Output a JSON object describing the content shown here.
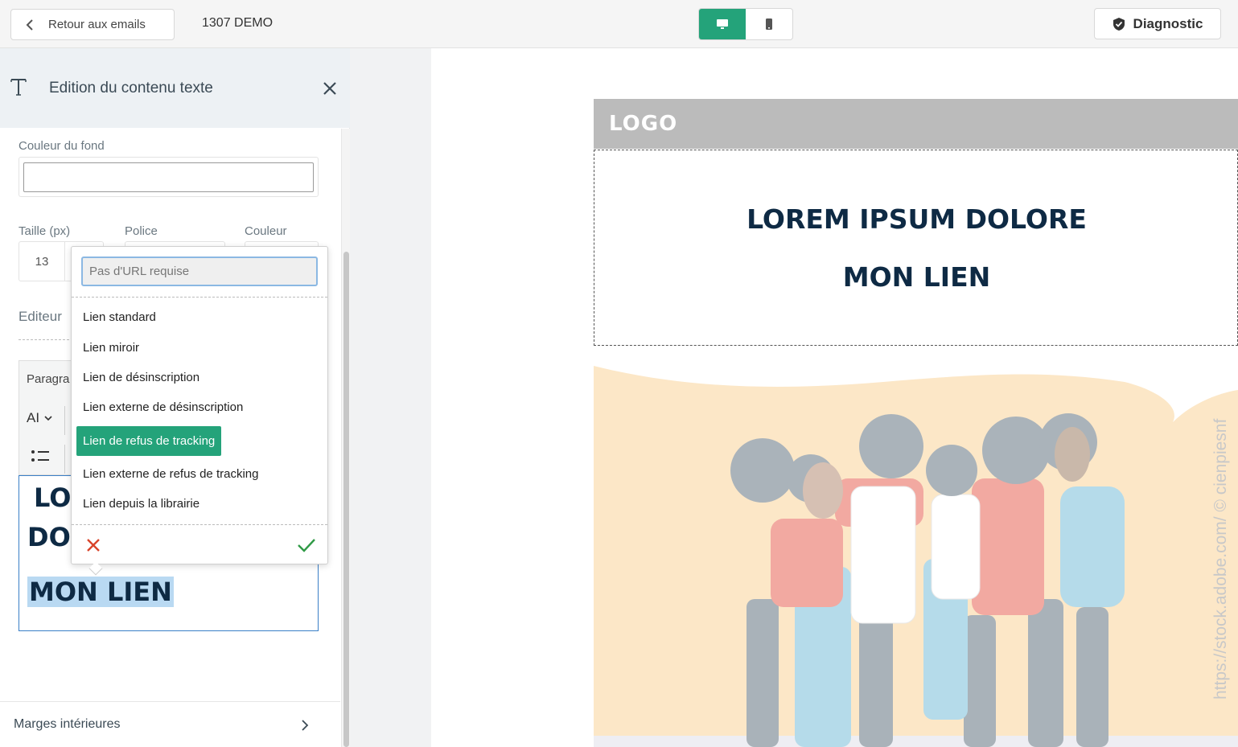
{
  "topbar": {
    "back_label": "Retour aux emails",
    "email_name": "1307 DEMO",
    "view_modes": [
      "desktop",
      "mobile"
    ],
    "active_view": "desktop",
    "diagnostic_label": "Diagnostic",
    "accent_color": "#24a37a"
  },
  "panel": {
    "title": "Edition du contenu texte",
    "bg_color_label": "Couleur du fond",
    "size_label": "Taille (px)",
    "size_value": "13",
    "font_label": "Police",
    "color_label": "Couleur",
    "editor_label": "Editeur",
    "toolbar": {
      "paragraph_label": "Paragra",
      "font_size_icon": "AI"
    },
    "content_lines": [
      "LO",
      "DO",
      "MON LIEN"
    ],
    "margins_label": "Marges intérieures"
  },
  "link_dropdown": {
    "url_placeholder": "Pas d'URL requise",
    "options": [
      "Lien standard",
      "Lien miroir",
      "Lien de désinscription",
      "Lien externe de désinscription",
      "Lien de refus de tracking",
      "Lien externe de refus de tracking",
      "Lien depuis la librairie"
    ],
    "selected": "Lien de refus de tracking"
  },
  "preview": {
    "logo": "LOGO",
    "heading": "LOREM IPSUM DOLORE",
    "link_text": "MON LIEN",
    "watermark": "https://stock.adobe.com/ © cienpiesnf"
  }
}
